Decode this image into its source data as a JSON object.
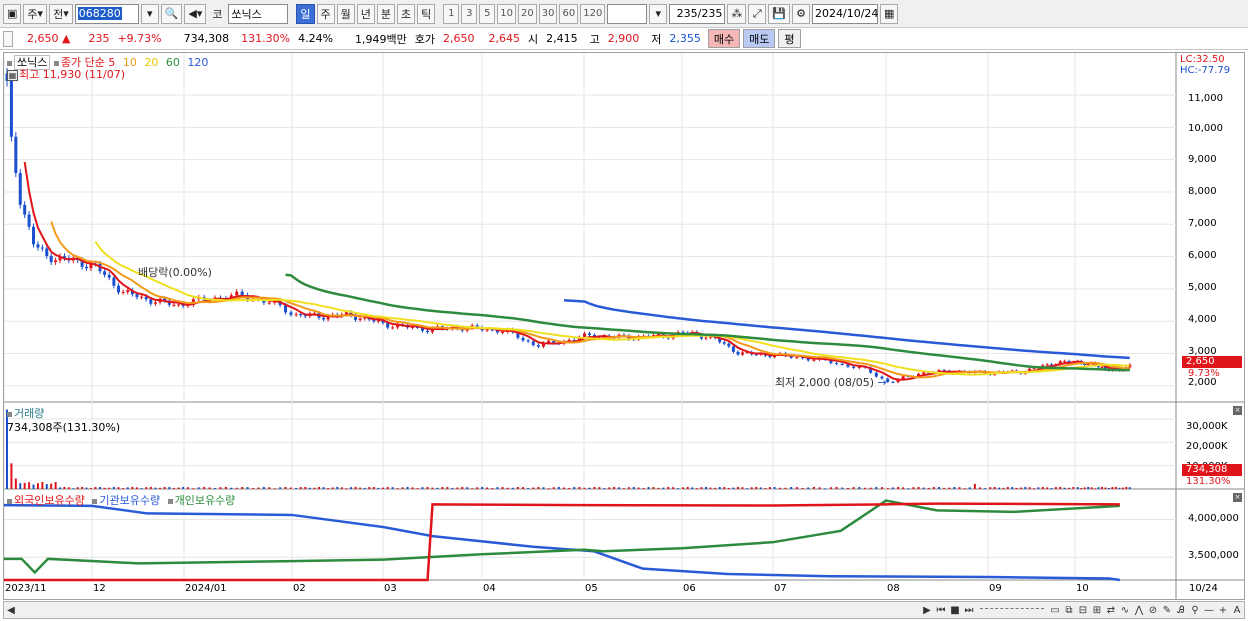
{
  "toolbar": {
    "market": "주",
    "prev": "전",
    "code": "068280",
    "name_prefix": "코",
    "name": "쏘닉스",
    "periods": [
      "일",
      "주",
      "월",
      "년",
      "분",
      "초",
      "틱"
    ],
    "active_period": "일",
    "nums": [
      "1",
      "3",
      "5",
      "10",
      "20",
      "30",
      "60",
      "120"
    ],
    "count": "235",
    "count_total": "/235",
    "date": "2024/10/24"
  },
  "quote": {
    "price": "2,650",
    "arrow": "▲",
    "change": "235",
    "change_pct": "+9.73%",
    "volume": "734,308",
    "vol_ratio": "131.30%",
    "turnover": "4.24%",
    "amount": "1,949백만",
    "ask_label": "호가",
    "ask1": "2,650",
    "ask2": "2,645",
    "open_label": "시",
    "open": "2,415",
    "high_label": "고",
    "high": "2,900",
    "low_label": "저",
    "low": "2,355",
    "buy_label": "매수",
    "sell_label": "매도",
    "eval_label": "평"
  },
  "price_panel": {
    "name": "쏘닉스",
    "ma_label": "종가 단순",
    "ma_periods": [
      {
        "p": "5",
        "color": "#e0151b"
      },
      {
        "p": "10",
        "color": "#f29a1a"
      },
      {
        "p": "20",
        "color": "#e8d800"
      },
      {
        "p": "60",
        "color": "#2e8b3e"
      },
      {
        "p": "120",
        "color": "#2a5bd7"
      }
    ],
    "high_note": "최고 11,930 (11/07)",
    "low_note": "최저 2,000 (08/05)",
    "dividend_note": "배당락(0.00%)",
    "lc": "LC:32.50",
    "hc": "HC:-77.79",
    "price_tag": "2,650",
    "pct_tag": "9.73%",
    "y_ticks": [
      "11,000",
      "10,000",
      "9,000",
      "8,000",
      "7,000",
      "6,000",
      "5,000",
      "4,000",
      "3,000",
      "2,000"
    ]
  },
  "volume_panel": {
    "title": "거래량",
    "value_note": "734,308주(131.30%)",
    "y_ticks": [
      "30,000K",
      "20,000K",
      "10,000K"
    ],
    "tag": "734,308",
    "tag_pct": "131.30%"
  },
  "holdings_panel": {
    "series": [
      {
        "name": "외국인보유수량",
        "color": "#e0151b"
      },
      {
        "name": "기관보유수량",
        "color": "#2a5bd7"
      },
      {
        "name": "개인보유수량",
        "color": "#2e8b3e"
      }
    ],
    "y_ticks": [
      "4,000,000",
      "3,500,000"
    ]
  },
  "x_axis": {
    "labels": [
      "2023/11",
      "12",
      "2024/01",
      "02",
      "03",
      "04",
      "05",
      "06",
      "07",
      "08",
      "09",
      "10"
    ],
    "right_label": "10/24"
  },
  "chart_data": {
    "type": "line",
    "x": [
      "2023-11",
      "2023-12",
      "2024-01",
      "2024-02",
      "2024-03",
      "2024-04",
      "2024-05",
      "2024-06",
      "2024-07",
      "2024-08",
      "2024-09",
      "2024-10"
    ],
    "series": [
      {
        "name": "5",
        "values": [
          9500,
          5000,
          4700,
          4100,
          3800,
          3300,
          3500,
          3600,
          3000,
          2300,
          2450,
          2650
        ]
      },
      {
        "name": "60",
        "values": [
          null,
          null,
          null,
          5100,
          4200,
          3700,
          3500,
          3500,
          3100,
          2800,
          2600,
          2550
        ]
      },
      {
        "name": "120",
        "values": [
          null,
          null,
          null,
          null,
          null,
          null,
          4500,
          3900,
          3400,
          3200,
          3000,
          2850
        ]
      }
    ],
    "ylim": [
      2000,
      11930
    ]
  },
  "colors": {
    "up": "#e0151b",
    "down": "#1a4fd0",
    "grid": "#e6e6e6"
  }
}
